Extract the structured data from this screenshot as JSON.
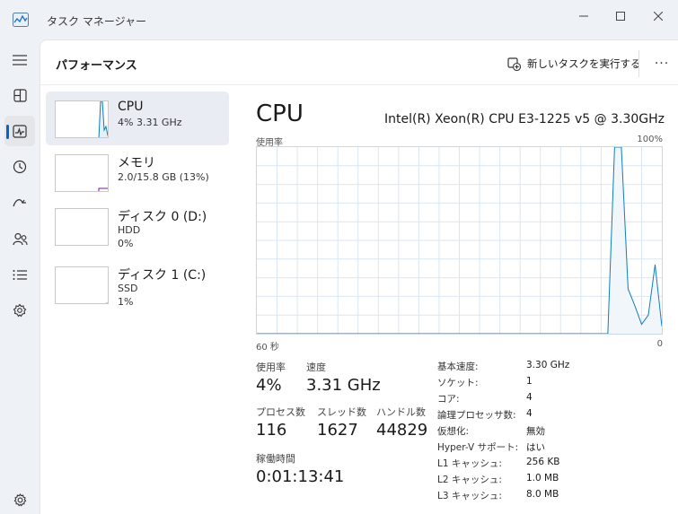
{
  "window": {
    "title": "タスク マネージャー",
    "controls": {
      "minimize": "—",
      "maximize": "☐",
      "close": "✕"
    }
  },
  "nav": {
    "items": [
      {
        "name": "hamburger-menu",
        "icon": "hamburger-icon"
      },
      {
        "name": "processes",
        "icon": "processes-icon"
      },
      {
        "name": "performance",
        "icon": "performance-icon",
        "active": true
      },
      {
        "name": "app-history",
        "icon": "history-icon"
      },
      {
        "name": "startup-apps",
        "icon": "startup-icon"
      },
      {
        "name": "users",
        "icon": "users-icon"
      },
      {
        "name": "details",
        "icon": "details-icon"
      },
      {
        "name": "services",
        "icon": "services-icon"
      },
      {
        "name": "settings",
        "icon": "gear-icon"
      }
    ]
  },
  "header": {
    "title": "パフォーマンス",
    "run_task": "新しいタスクを実行する",
    "more": "···"
  },
  "resources": [
    {
      "name": "CPU",
      "sub": "4%  3.31 GHz",
      "color": "#117dbb",
      "selected": true
    },
    {
      "name": "メモリ",
      "sub": "2.0/15.8 GB (13%)",
      "color": "#8b12ae"
    },
    {
      "name": "ディスク 0 (D:)",
      "sub": "HDD",
      "sub2": "0%",
      "color": "#4da60c"
    },
    {
      "name": "ディスク 1 (C:)",
      "sub": "SSD",
      "sub2": "1%",
      "color": "#4da60c"
    }
  ],
  "detail": {
    "title": "CPU",
    "processor": "Intel(R) Xeon(R) CPU E3-1225 v5 @ 3.30GHz",
    "graph": {
      "ylabel": "使用率",
      "ymax_label": "100%",
      "xleft_label": "60 秒",
      "xright_label": "0",
      "line_color": "#117dbb",
      "fill_color": "#f1f6fa",
      "grid_color": "#d9e6f2"
    },
    "stats": {
      "usage_label": "使用率",
      "usage_value": "4%",
      "speed_label": "速度",
      "speed_value": "3.31 GHz",
      "processes_label": "プロセス数",
      "processes_value": "116",
      "threads_label": "スレッド数",
      "threads_value": "1627",
      "handles_label": "ハンドル数",
      "handles_value": "44829",
      "uptime_label": "稼働時間",
      "uptime_value": "0:01:13:41"
    },
    "specs": [
      {
        "key": "基本速度:",
        "value": "3.30 GHz"
      },
      {
        "key": "ソケット:",
        "value": "1"
      },
      {
        "key": "コア:",
        "value": "4"
      },
      {
        "key": "論理プロセッサ数:",
        "value": "4"
      },
      {
        "key": "仮想化:",
        "value": "無効"
      },
      {
        "key": "Hyper-V サポート:",
        "value": "はい"
      },
      {
        "key": "L1 キャッシュ:",
        "value": "256 KB"
      },
      {
        "key": "L2 キャッシュ:",
        "value": "1.0 MB"
      },
      {
        "key": "L3 キャッシュ:",
        "value": "8.0 MB"
      }
    ]
  },
  "chart_data": {
    "type": "area",
    "ylim": [
      0,
      100
    ],
    "xlim": [
      60,
      0
    ],
    "x": [
      60,
      59,
      58,
      57,
      56,
      55,
      54,
      53,
      52,
      51,
      50,
      49,
      48,
      47,
      46,
      45,
      44,
      43,
      42,
      41,
      40,
      39,
      38,
      37,
      36,
      35,
      34,
      33,
      32,
      31,
      30,
      29,
      28,
      27,
      26,
      25,
      24,
      23,
      22,
      21,
      20,
      19,
      18,
      17,
      16,
      15,
      14,
      13,
      12,
      11,
      10,
      9,
      8,
      7,
      6,
      5,
      4,
      3,
      2,
      1,
      0
    ],
    "values": [
      0,
      0,
      0,
      0,
      0,
      0,
      0,
      0,
      0,
      0,
      0,
      0,
      0,
      0,
      0,
      0,
      0,
      0,
      0,
      0,
      0,
      0,
      0,
      0,
      0,
      0,
      0,
      0,
      0,
      0,
      0,
      0,
      0,
      0,
      0,
      0,
      0,
      0,
      0,
      0,
      0,
      0,
      0,
      0,
      0,
      0,
      0,
      0,
      0,
      0,
      0,
      0,
      0,
      100,
      100,
      24,
      15,
      5,
      10,
      37,
      4
    ]
  }
}
